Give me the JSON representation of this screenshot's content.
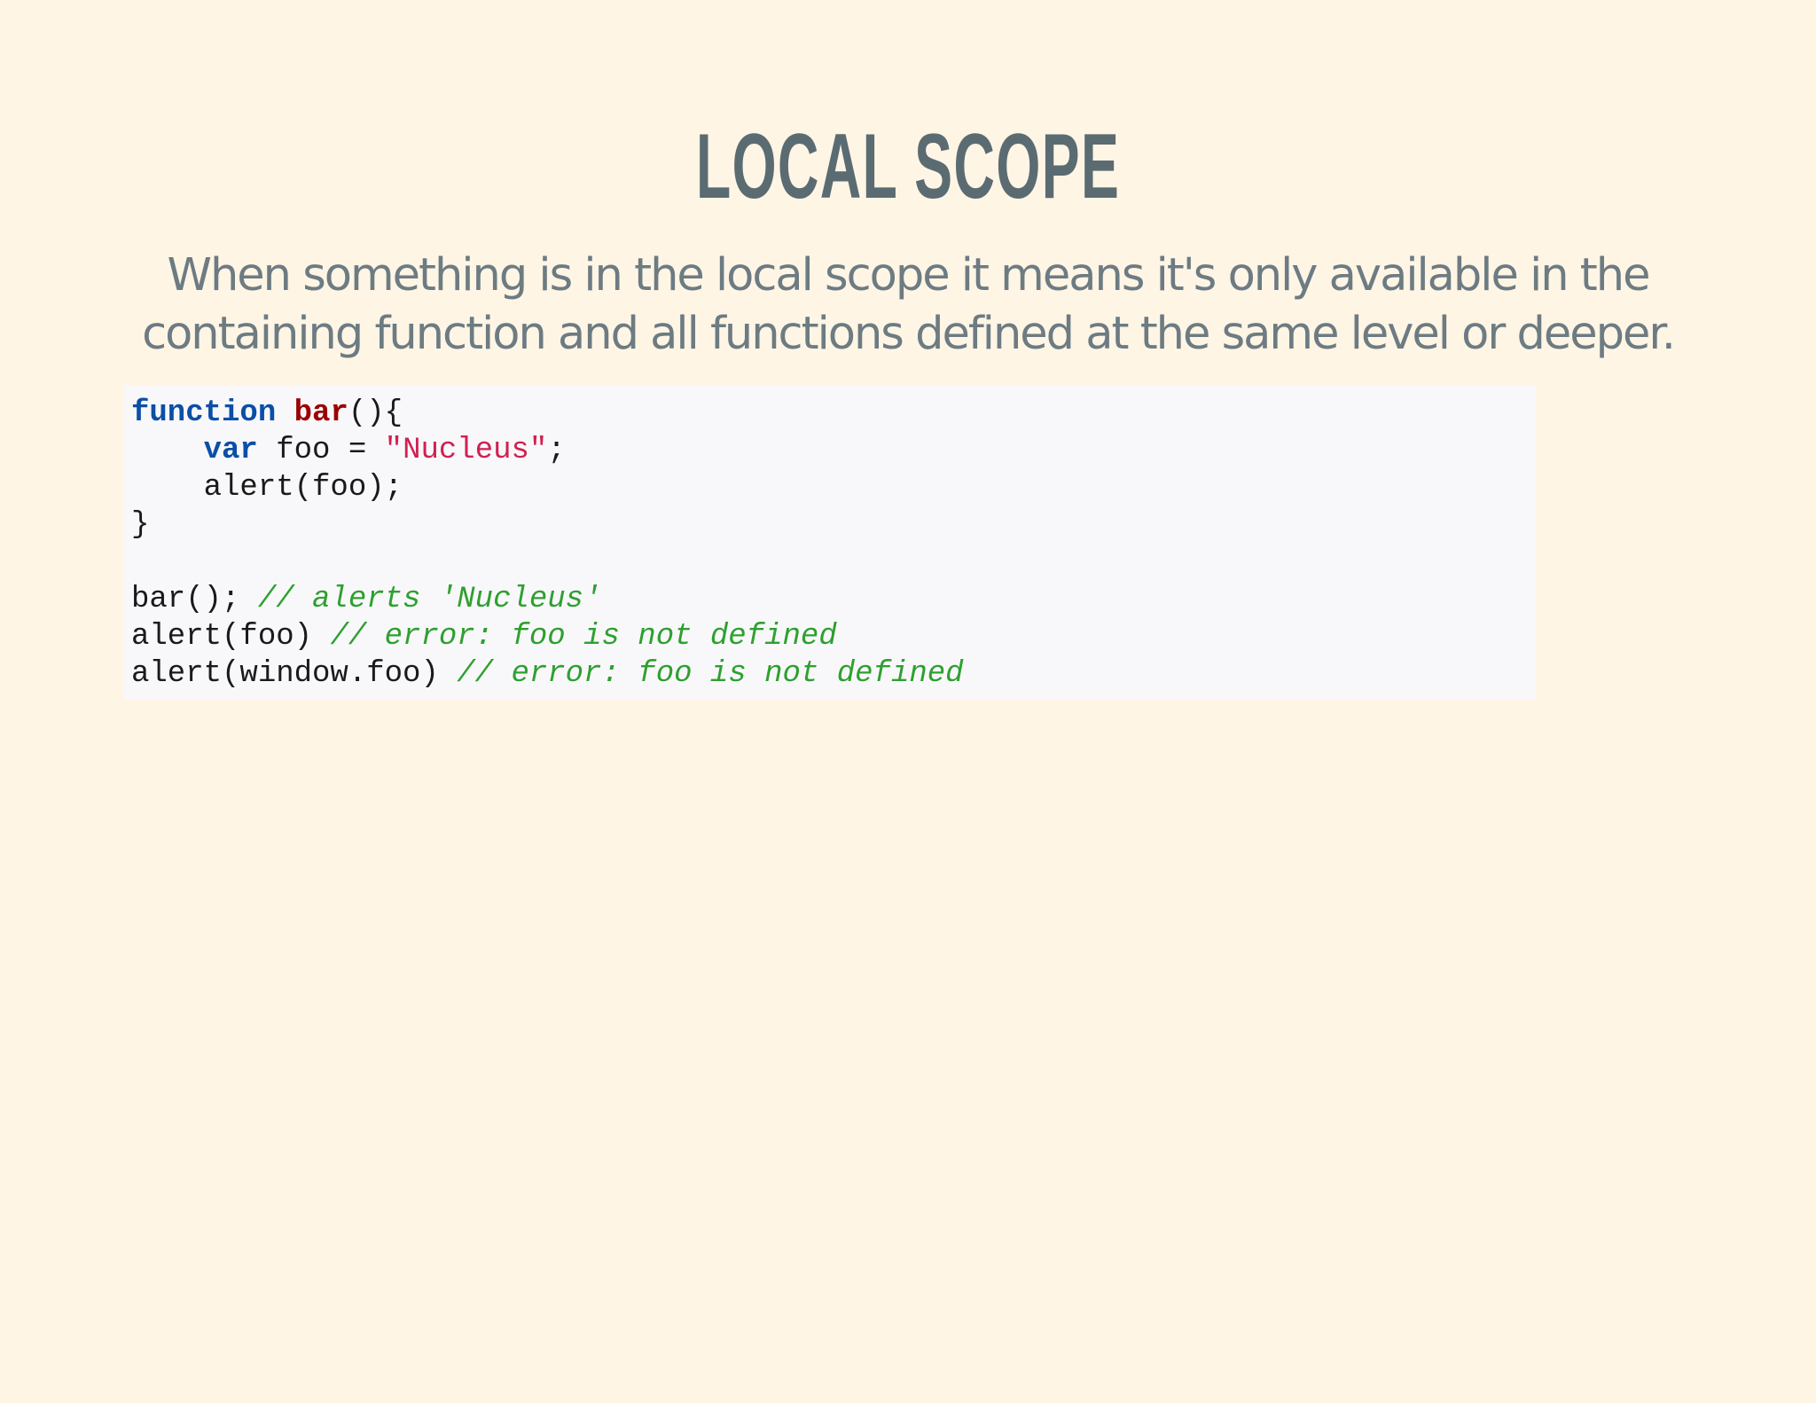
{
  "slide": {
    "title": "LOCAL SCOPE",
    "subtitle": "When something is in the local scope it means it's only available in the containing function and all functions defined at the same level or deeper."
  },
  "code": {
    "line1": {
      "keyword": "function",
      "space": " ",
      "name": "bar",
      "rest": "(){"
    },
    "line2": {
      "indent": "    ",
      "keyword": "var",
      "text": " foo = ",
      "string": "\"Nucleus\"",
      "rest": ";"
    },
    "line3": {
      "text": "    alert(foo);"
    },
    "line4": {
      "text": "}"
    },
    "line5": {
      "text": ""
    },
    "line6": {
      "text": "bar(); ",
      "comment": "// alerts 'Nucleus'"
    },
    "line7": {
      "text": "alert(foo) ",
      "comment": "// error: foo is not defined"
    },
    "line8": {
      "text": "alert(window.foo) ",
      "comment": "// error: foo is not defined"
    }
  },
  "colors": {
    "background": "#fef5e5",
    "title": "#5b6b72",
    "subtitle": "#6d7b82",
    "code_background": "#f8f8fb",
    "keyword": "#0b4fa6",
    "function_name": "#9c0000",
    "string": "#d1204f",
    "comment": "#2ea02e"
  }
}
